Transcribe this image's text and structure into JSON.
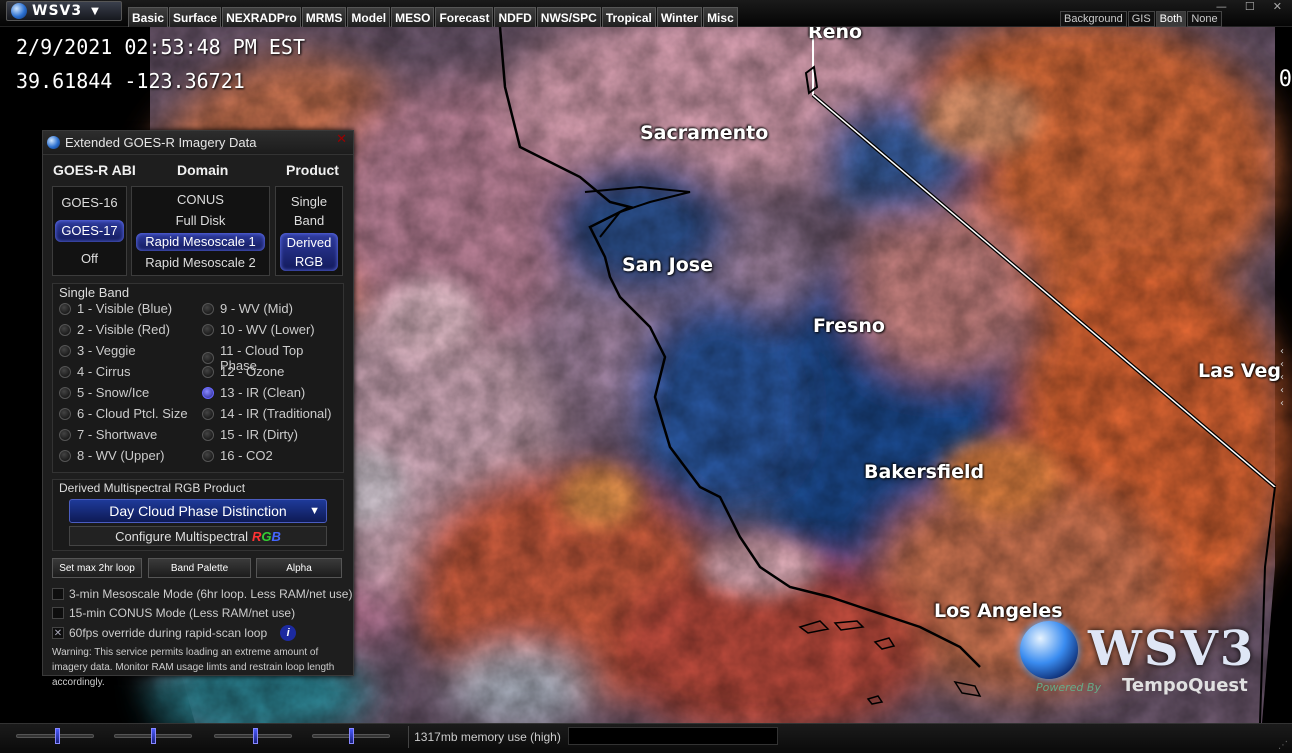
{
  "app": {
    "name": "WSV3",
    "caret": "▼"
  },
  "menu": [
    "Basic",
    "Surface",
    "NEXRADPro",
    "MRMS",
    "Model",
    "MESO",
    "Forecast",
    "NDFD",
    "NWS/SPC",
    "Tropical",
    "Winter",
    "Misc"
  ],
  "layer_toggle": {
    "options": [
      "Background",
      "GIS",
      "Both",
      "None"
    ],
    "active": "Both"
  },
  "window_controls": {
    "minimize": "—",
    "maximize": "☐",
    "close": "✕"
  },
  "readout": {
    "datetime": "2/9/2021  02:53:48  PM  EST",
    "coords": "39.61844  -123.36721"
  },
  "edge_glyph": "0",
  "cities": [
    "Reno",
    "Sacramento",
    "San Jose",
    "Fresno",
    "Las Veg",
    "Bakersfield",
    "Los Angeles"
  ],
  "panel": {
    "title": "Extended GOES-R Imagery Data",
    "close": "✕",
    "headers": {
      "abi": "GOES-R ABI",
      "domain": "Domain",
      "product": "Product"
    },
    "satellites": [
      "GOES-16",
      "GOES-17",
      "Off"
    ],
    "satellite_selected": "GOES-17",
    "domains": [
      "CONUS",
      "Full Disk",
      "Rapid Mesoscale 1",
      "Rapid Mesoscale 2"
    ],
    "domain_selected": "Rapid Mesoscale 1",
    "products": {
      "single": [
        "Single",
        "Band"
      ],
      "derived": [
        "Derived",
        "RGB"
      ]
    },
    "product_selected": "Derived RGB",
    "single_band_title": "Single Band",
    "bands_left": [
      "1 - Visible (Blue)",
      "2 - Visible (Red)",
      "3 - Veggie",
      "4 - Cirrus",
      "5 - Snow/Ice",
      "6 - Cloud Ptcl. Size",
      "7 - Shortwave",
      "8 - WV (Upper)"
    ],
    "bands_right": [
      "9 - WV (Mid)",
      "10 - WV (Lower)",
      "11 - Cloud Top Phase",
      "12 - Ozone",
      "13 - IR (Clean)",
      "14 - IR (Traditional)",
      "15 - IR (Dirty)",
      "16 - CO2"
    ],
    "band_selected": "13 - IR (Clean)",
    "rgb_title": "Derived Multispectral RGB Product",
    "rgb_selected": "Day Cloud Phase Distinction",
    "rgb_arrow": "▼",
    "configure": {
      "prefix": "Configure Multispectral",
      "r": "R",
      "g": "G",
      "b": "B"
    },
    "buttons": {
      "loop": "Set max 2hr loop",
      "palette": "Band Palette",
      "alpha": "Alpha"
    },
    "checkboxes": [
      {
        "label": "3-min Mesoscale Mode (6hr loop. Less RAM/net use)",
        "checked": false
      },
      {
        "label": "15-min CONUS Mode (Less RAM/net use)",
        "checked": false
      },
      {
        "label": "60fps override during rapid-scan loop",
        "checked": true
      }
    ],
    "check_mark": "✕",
    "info": "i",
    "warning": "Warning: This service permits loading an extreme amount of imagery data. Monitor RAM usage limts and restrain loop length accordingly."
  },
  "logo": {
    "brand": "WSV3",
    "powered": "Powered By",
    "company": "TempoQuest"
  },
  "status": {
    "memory": "1317mb memory use (high)"
  },
  "colors": {
    "accent": "#2f3ca0",
    "selection_glow": "#6c7cff",
    "memory_high": "#ccc"
  }
}
